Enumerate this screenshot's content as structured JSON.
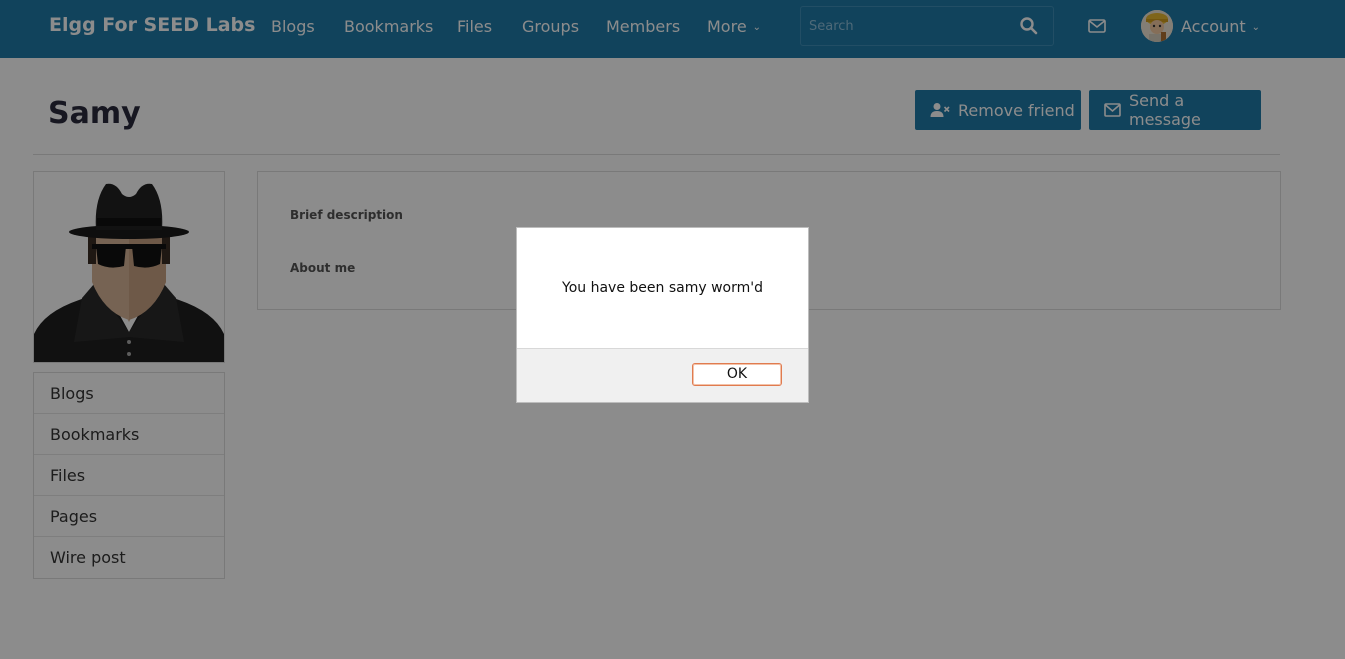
{
  "header": {
    "brand": "Elgg For SEED Labs",
    "nav": [
      "Blogs",
      "Bookmarks",
      "Files",
      "Groups",
      "Members",
      "More"
    ],
    "search_placeholder": "Search",
    "account_label": "Account",
    "bar_color": "#1f7aa8"
  },
  "profile": {
    "name": "Samy",
    "actions": {
      "remove_friend": "Remove friend",
      "send_message": "Send a message"
    },
    "fields": {
      "brief_description": "Brief description",
      "about_me": "About me"
    },
    "menu": [
      "Blogs",
      "Bookmarks",
      "Files",
      "Pages",
      "Wire post"
    ]
  },
  "dialog": {
    "message": "You have been samy worm'd",
    "ok_label": "OK"
  },
  "icons": {
    "search": "search-icon",
    "mail": "envelope-icon",
    "remove_friend": "user-times-icon",
    "send_message": "envelope-icon",
    "more": "chevron-down-icon"
  }
}
